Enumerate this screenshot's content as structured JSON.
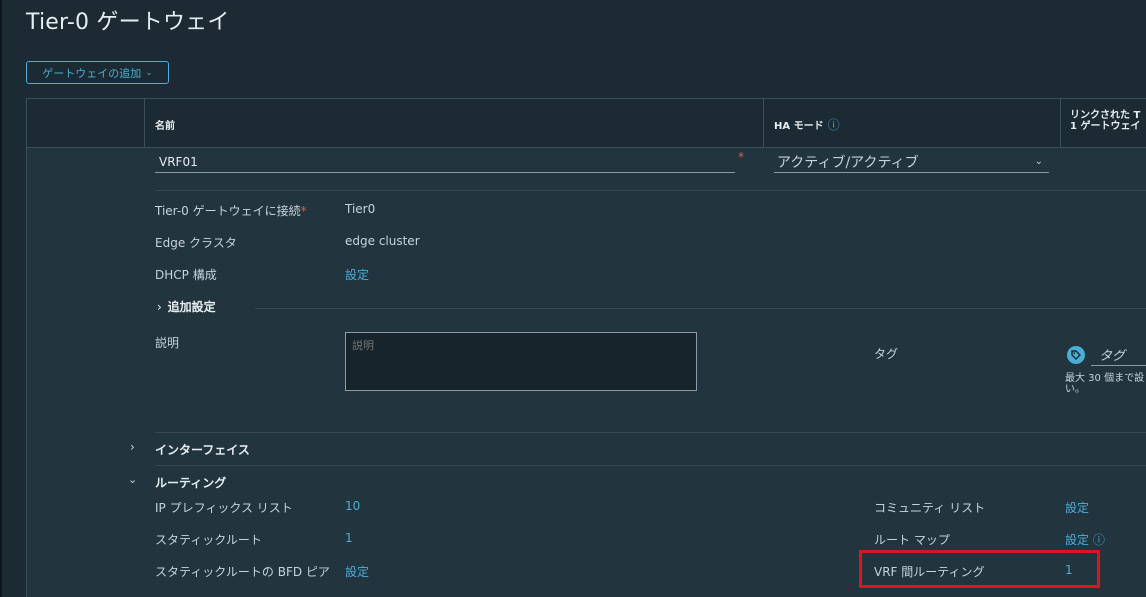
{
  "page": {
    "title": "Tier-0 ゲートウェイ"
  },
  "toolbar": {
    "add_gateway_label": "ゲートウェイの追加"
  },
  "grid": {
    "columns": {
      "name": "名前",
      "ha_mode": "HA モード",
      "linked_line1": "リンクされた T",
      "linked_line2": "1 ゲートウェイ"
    }
  },
  "form": {
    "name_value": "VRF01",
    "ha_mode_value": "アクティブ/アクティブ",
    "connect_label": "Tier-0 ゲートウェイに接続",
    "connect_value": "Tier0",
    "edge_cluster_label": "Edge クラスタ",
    "edge_cluster_value": "edge cluster",
    "dhcp_label": "DHCP 構成",
    "dhcp_link": "設定",
    "additional_settings": "追加設定",
    "description_label": "説明",
    "description_placeholder": "説明",
    "tag_label": "タグ",
    "tag_placeholder": "タグ",
    "tag_note_line1": "最大 30 個まで設",
    "tag_note_line2": "い。"
  },
  "sections": {
    "interfaces": "インターフェイス",
    "routing": "ルーティング"
  },
  "routing": {
    "ip_prefix_label": "IP プレフィックス リスト",
    "ip_prefix_value": "10",
    "static_route_label": "スタティックルート",
    "static_route_value": "1",
    "bfd_label": "スタティックルートの BFD ピア",
    "bfd_link": "設定",
    "community_label": "コミュニティ リスト",
    "community_link": "設定",
    "route_map_label": "ルート マップ",
    "route_map_link": "設定",
    "vrf_label": "VRF 間ルーティング",
    "vrf_value": "1"
  },
  "colors": {
    "accent": "#49afd9",
    "highlight": "#e0121d",
    "required": "#e05b4a"
  }
}
